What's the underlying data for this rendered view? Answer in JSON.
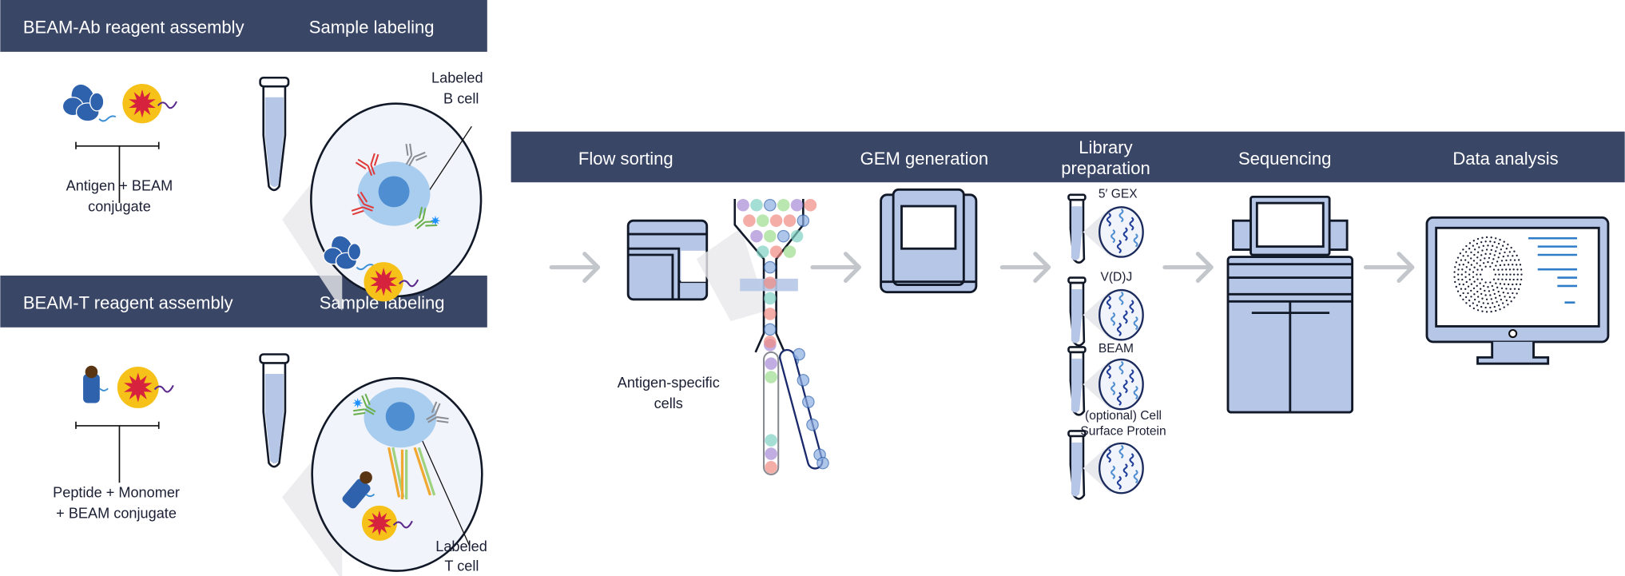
{
  "colors": {
    "header": "#3a4666",
    "instrument_fill": "#b5c6e7",
    "antigen_blue": "#2e62ad",
    "bead_yellow": "#f6c21a",
    "bead_star": "#d7223d",
    "cell_fill": "#a9cdee",
    "arrow": "#c3c7cc"
  },
  "panel_b": {
    "headers": [
      "BEAM-Ab reagent assembly",
      "Sample labeling"
    ],
    "assembly_label": [
      "Antigen + BEAM",
      "conjugate"
    ],
    "cell_label": [
      "Labeled",
      "B cell"
    ]
  },
  "panel_t": {
    "headers": [
      "BEAM-T reagent assembly",
      "Sample labeling"
    ],
    "assembly_label": [
      "Peptide + Monomer",
      "+ BEAM conjugate"
    ],
    "cell_label": [
      "Labeled",
      "T cell"
    ]
  },
  "workflow": {
    "steps": [
      "Flow sorting",
      "GEM generation",
      "Library",
      "preparation",
      "Sequencing",
      "Data analysis"
    ],
    "sorted_label": [
      "Antigen-specific",
      "cells"
    ],
    "libraries": [
      "5′ GEX",
      "V(D)J",
      "BEAM",
      "(optional) Cell",
      "Surface Protein"
    ]
  }
}
